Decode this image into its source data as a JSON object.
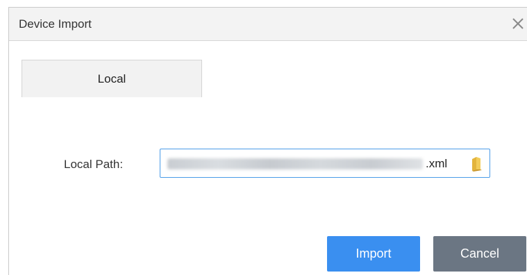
{
  "dialog": {
    "title": "Device Import",
    "close_icon": "close-icon",
    "tabs": [
      {
        "label": "Local"
      }
    ],
    "local_path": {
      "label": "Local Path:",
      "value_suffix": ".xml",
      "value_obscured": true,
      "browse_icon": "folder-icon"
    },
    "buttons": {
      "import_label": "Import",
      "cancel_label": "Cancel"
    }
  },
  "colors": {
    "primary_button": "#3a8ff0",
    "secondary_button": "#6b7683",
    "input_focus_border": "#4a9be8"
  }
}
